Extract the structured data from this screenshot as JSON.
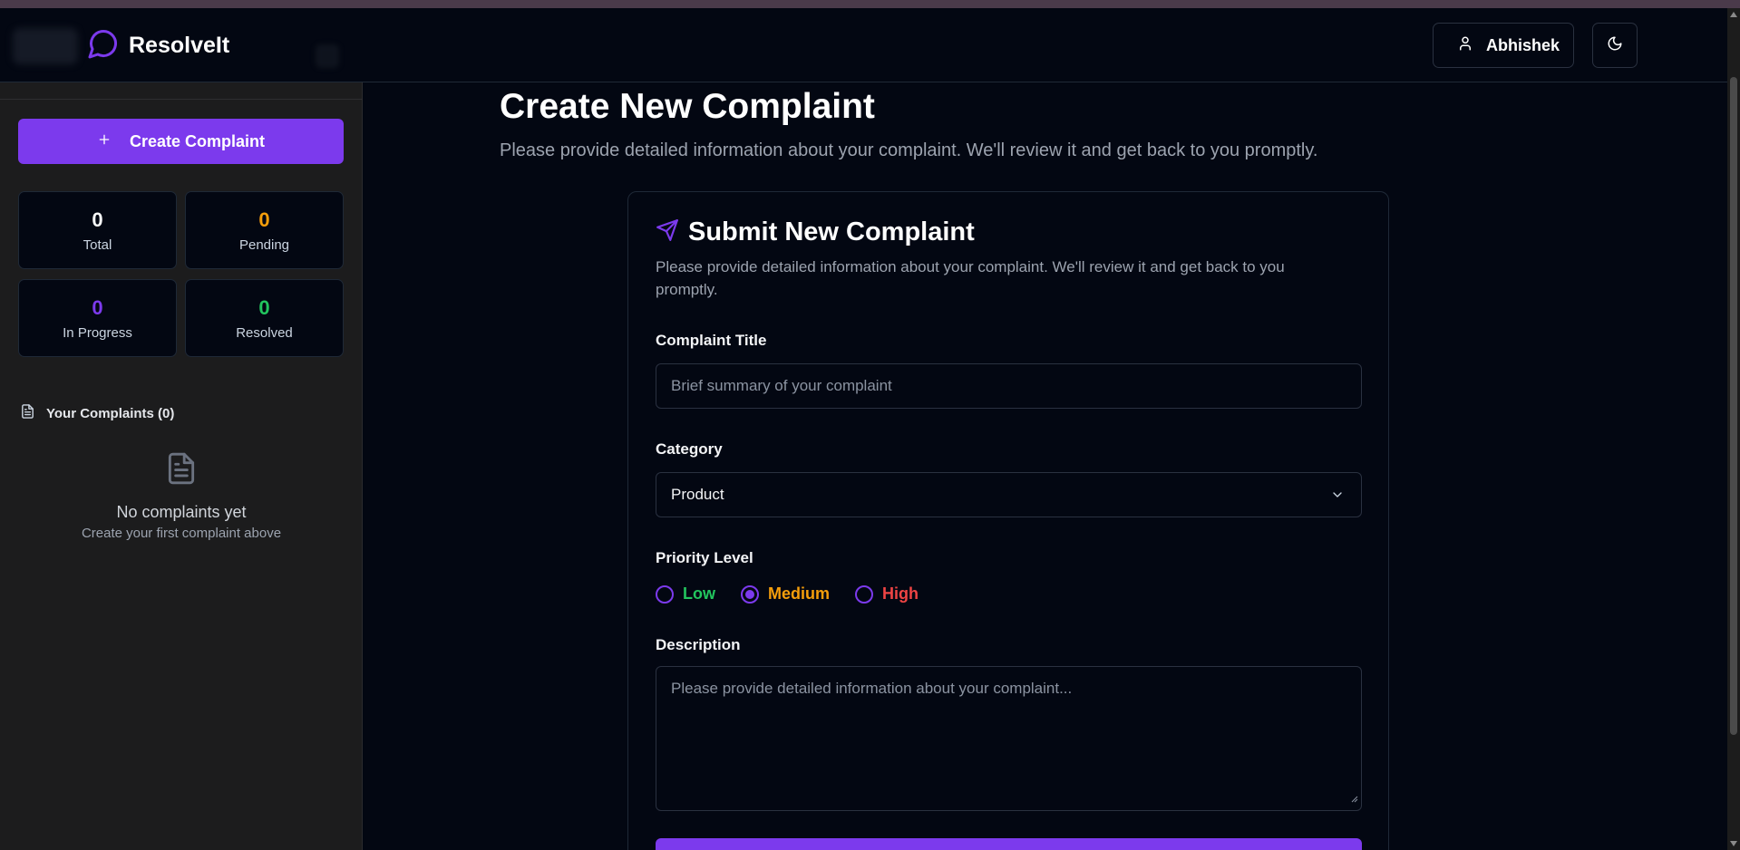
{
  "header": {
    "brand": "ResolveIt",
    "user_name": "Abhishek"
  },
  "sidebar": {
    "create_label": "Create Complaint",
    "stats": [
      {
        "value": "0",
        "label": "Total",
        "color": "#f9fafb"
      },
      {
        "value": "0",
        "label": "Pending",
        "color": "#f59e0b"
      },
      {
        "value": "0",
        "label": "In Progress",
        "color": "#7c3aed"
      },
      {
        "value": "0",
        "label": "Resolved",
        "color": "#22c55e"
      }
    ],
    "complaints_heading": "Your Complaints (0)",
    "empty_title": "No complaints yet",
    "empty_subtitle": "Create your first complaint above"
  },
  "main": {
    "title": "Create New Complaint",
    "subtitle": "Please provide detailed information about your complaint. We'll review it and get back to you promptly."
  },
  "form": {
    "title": "Submit New Complaint",
    "description": "Please provide detailed information about your complaint. We'll review it and get back to you promptly.",
    "title_label": "Complaint Title",
    "title_placeholder": "Brief summary of your complaint",
    "category_label": "Category",
    "category_value": "Product",
    "priority_label": "Priority Level",
    "priorities": [
      {
        "label": "Low",
        "color": "#22c55e",
        "selected": false
      },
      {
        "label": "Medium",
        "color": "#f59e0b",
        "selected": true
      },
      {
        "label": "High",
        "color": "#ef4444",
        "selected": false
      }
    ],
    "description_label": "Description",
    "description_placeholder": "Please provide detailed information about your complaint..."
  },
  "colors": {
    "accent": "#7c3aed",
    "background": "#030712",
    "sidebar": "#1c1c1d"
  }
}
